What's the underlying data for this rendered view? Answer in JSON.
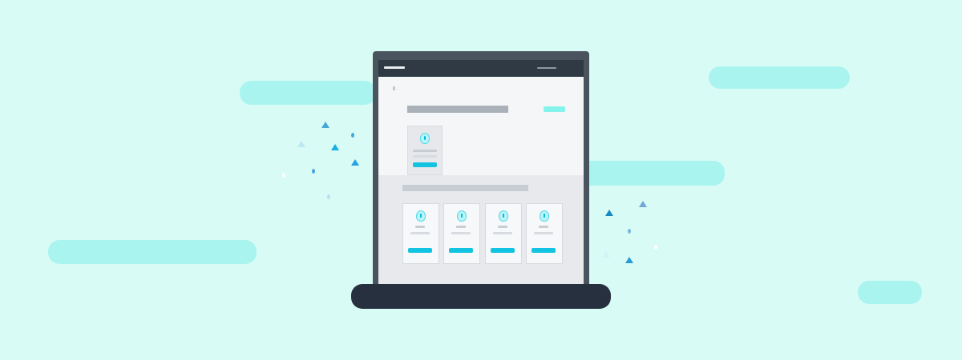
{
  "scene": {
    "background": "#d8fbf5",
    "cloud_color": "#9ff2ef",
    "laptop_frame": "#4a545f",
    "laptop_base": "#26303f",
    "accent": "#13c3e2"
  },
  "laptop": {
    "device_icon": "laptop-icon",
    "screen": {
      "topbar_icon": "app-header-icon",
      "featured_card_icon": "profile-card-icon",
      "card_icon": "profile-card-icon"
    }
  },
  "decorations": {
    "cloud_icon": "cloud-icon",
    "spark_icon": "sparkle-icon"
  }
}
